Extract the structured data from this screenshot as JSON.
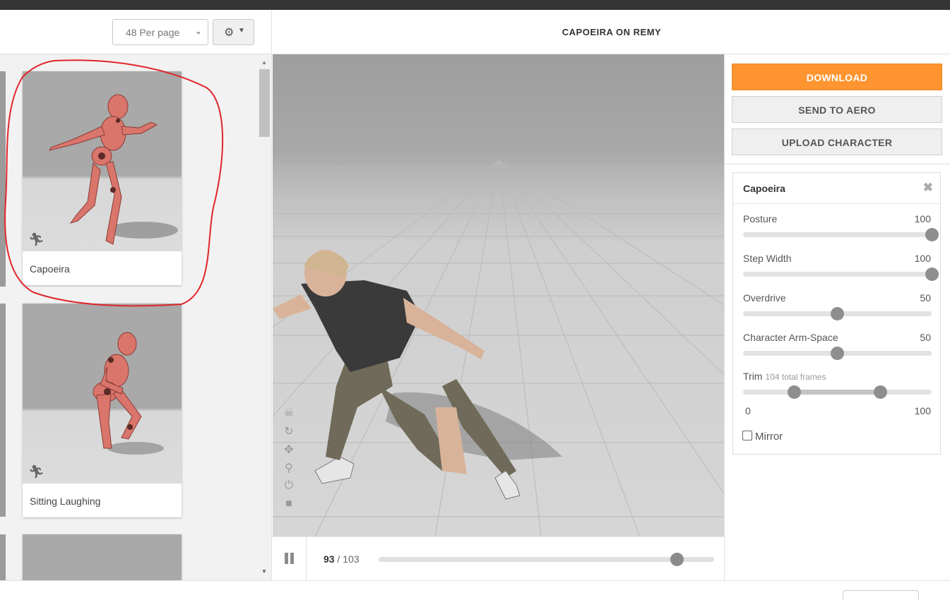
{
  "toolbar": {
    "per_page_label": "48 Per page",
    "gear_icon": "gear-icon"
  },
  "gallery": {
    "cards": [
      {
        "label": "Capoeira",
        "icon": "running-person-icon",
        "highlighted": true
      },
      {
        "label": "Sitting Laughing",
        "icon": "running-person-icon",
        "highlighted": false
      },
      {
        "label": "",
        "icon": "",
        "highlighted": false
      }
    ]
  },
  "viewer": {
    "title": "CAPOEIRA ON REMY",
    "current_frame": "93",
    "frame_separator": " / ",
    "total_frames": "103",
    "timeline_position": 0.89,
    "tools": [
      "skull-icon",
      "rotate-icon",
      "move-icon",
      "zoom-icon",
      "power-icon",
      "camera-icon"
    ]
  },
  "actions": {
    "download": "DOWNLOAD",
    "send_to_aero": "SEND TO AERO",
    "upload_character": "UPLOAD CHARACTER"
  },
  "settings": {
    "title": "Capoeira",
    "sliders": [
      {
        "label": "Posture",
        "value": "100",
        "fraction": 1.0
      },
      {
        "label": "Step Width",
        "value": "100",
        "fraction": 1.0
      },
      {
        "label": "Overdrive",
        "value": "50",
        "fraction": 0.5
      },
      {
        "label": "Character Arm-Space",
        "value": "50",
        "fraction": 0.5
      }
    ],
    "trim": {
      "label": "Trim",
      "hint": "104 total frames",
      "min": "0",
      "max": "100",
      "start_fraction": 0.27,
      "end_fraction": 0.73
    },
    "mirror_label": "Mirror"
  }
}
